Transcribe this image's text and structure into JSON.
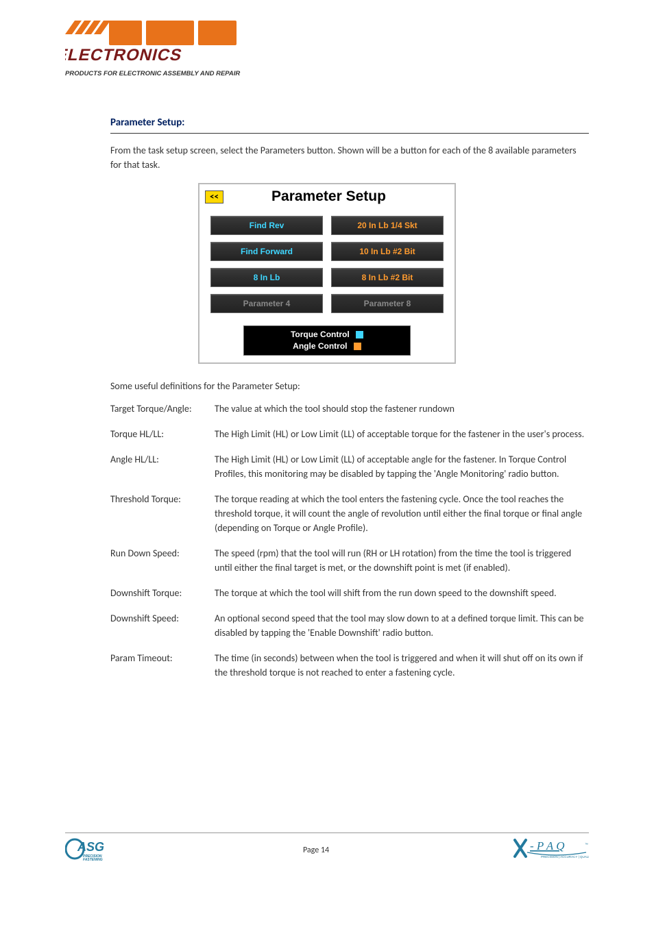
{
  "section": {
    "title": "Parameter Setup:",
    "intro": "From the task setup screen, select the Parameters button.  Shown will be a button for each of the 8 available parameters for that task."
  },
  "panel": {
    "back": "<<",
    "title": "Parameter Setup",
    "buttons": [
      {
        "label": "Find Rev",
        "cls": "torque"
      },
      {
        "label": "20 In Lb 1/4 Skt",
        "cls": "angle"
      },
      {
        "label": "Find Forward",
        "cls": "torque"
      },
      {
        "label": "10 In Lb #2 Bit",
        "cls": "angle"
      },
      {
        "label": "8 In Lb",
        "cls": "torque"
      },
      {
        "label": "8 In Lb #2 Bit",
        "cls": "angle"
      },
      {
        "label": "Parameter 4",
        "cls": "gray"
      },
      {
        "label": "Parameter 8",
        "cls": "gray"
      }
    ],
    "legend": {
      "torque": "Torque Control",
      "angle": "Angle Control"
    }
  },
  "defs": {
    "intro": "Some useful definitions for the Parameter Setup:",
    "rows": [
      {
        "term": "Target Torque/Angle:",
        "desc": "The value at which the tool should stop the fastener rundown"
      },
      {
        "term": "Torque HL/LL:",
        "desc": "The High Limit (HL) or Low Limit (LL) of acceptable torque for the fastener in the user's process."
      },
      {
        "term": "Angle HL/LL:",
        "desc": "The High Limit (HL) or Low Limit (LL) of acceptable angle for the fastener.  In Torque Control Profiles, this monitoring may be disabled by tapping the 'Angle Monitoring' radio button."
      },
      {
        "term": "Threshold Torque:",
        "desc": "The torque reading at which the tool enters the fastening cycle.  Once the tool reaches the threshold torque, it will count the angle of revolution until either the final torque or final angle (depending on Torque or Angle Profile)."
      },
      {
        "term": "Run Down Speed:",
        "desc": "The speed (rpm) that the tool will run (RH or LH rotation) from the time the tool is triggered until either the final target is met, or the downshift point is met (if enabled)."
      },
      {
        "term": "Downshift Torque:",
        "desc": "The torque at which the tool will shift from the run down speed to the downshift speed."
      },
      {
        "term": "Downshift Speed:",
        "desc": "An optional second speed that the tool may slow down to at a defined torque limit.  This can be disabled by tapping the 'Enable Downshift' radio button."
      },
      {
        "term": "Param Timeout:",
        "desc": "The time (in seconds) between when the tool is triggered and when it will shut off on its own if the threshold torque is not reached to enter a fastening cycle."
      }
    ]
  },
  "footer": {
    "page": "Page 14",
    "logos": {
      "header": "HMC ELECTRONICS — PRODUCTS FOR ELECTRONIC ASSEMBLY AND REPAIR",
      "left": "ASG PRECISION FASTENING",
      "right": "X-PAQ PRECISION | ACCURACY | QUALITY"
    }
  }
}
